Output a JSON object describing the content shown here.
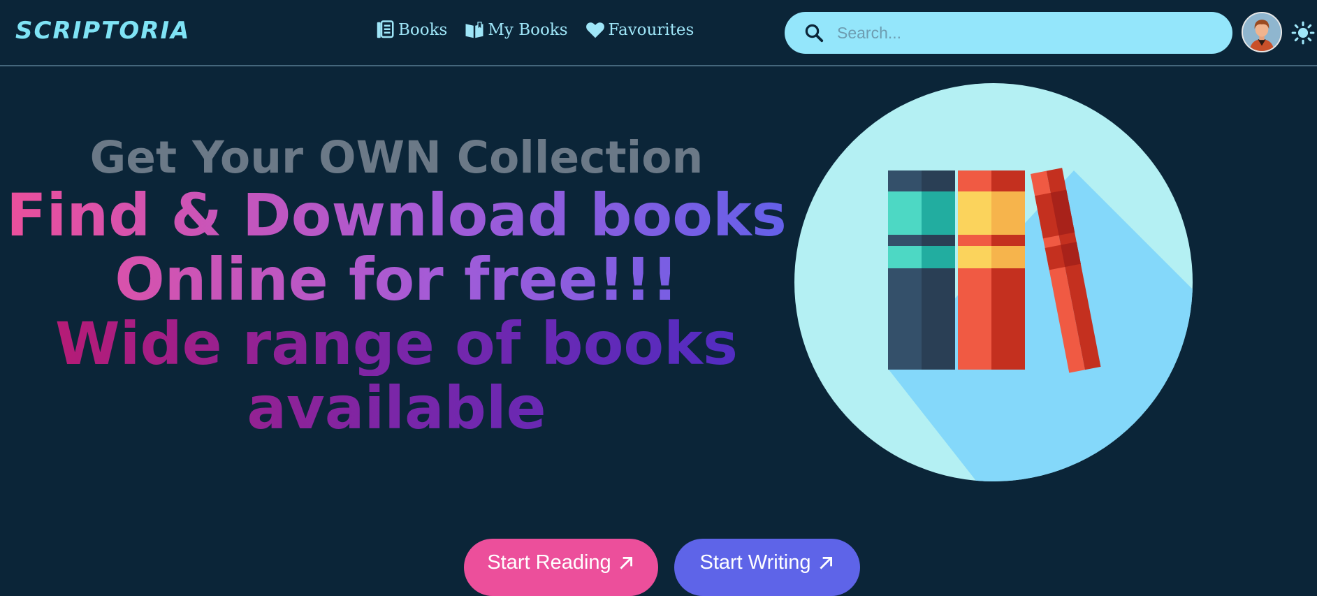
{
  "brand": {
    "logo_text": "SCRIPTORIA"
  },
  "nav": {
    "items": [
      {
        "label": "Books",
        "icon": "book-list-icon"
      },
      {
        "label": "My Books",
        "icon": "open-book-icon"
      },
      {
        "label": "Favourites",
        "icon": "heart-icon"
      }
    ]
  },
  "search": {
    "placeholder": "Search...",
    "value": ""
  },
  "user": {
    "avatar_icon": "user-avatar"
  },
  "theme": {
    "icon": "sun-icon"
  },
  "hero": {
    "tagline": "Get Your OWN Collection",
    "headline_line1": "Find & Download books",
    "headline_line2": "Online for free!!!",
    "subline_line1": "Wide range of books",
    "subline_line2": "available"
  },
  "actions": {
    "start_reading_label": "Start Reading",
    "start_writing_label": "Start Writing"
  },
  "colors": {
    "background": "#0b2538",
    "accent": "#7fe3f5",
    "search_bg": "#94e6fb",
    "pink": "#ec4f9b",
    "indigo": "#5e64e8"
  }
}
